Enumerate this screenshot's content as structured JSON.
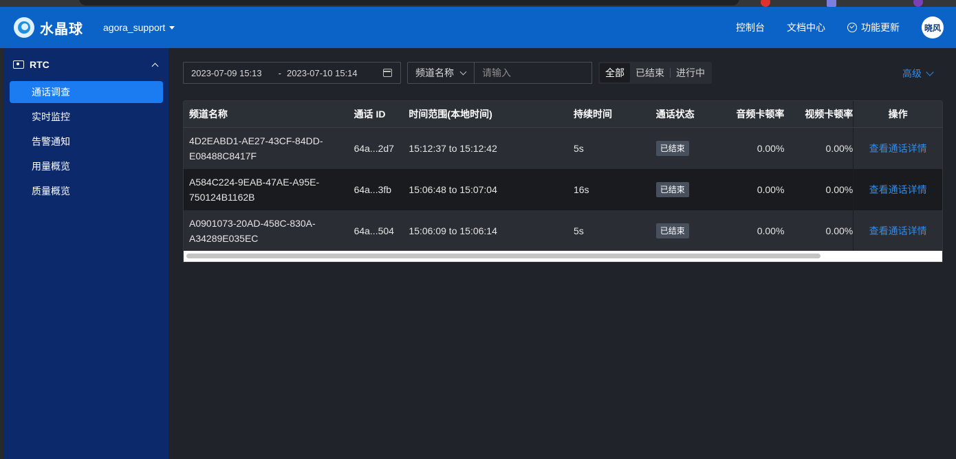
{
  "app": {
    "logo_text": "水晶球",
    "account": "agora_support"
  },
  "topnav": {
    "console": "控制台",
    "docs": "文档中心",
    "updates": "功能更新",
    "avatar": "晓风"
  },
  "sidebar": {
    "section": "RTC",
    "items": [
      {
        "label": "通话调查",
        "active": true
      },
      {
        "label": "实时监控"
      },
      {
        "label": "告警通知"
      },
      {
        "label": "用量概览"
      },
      {
        "label": "质量概览"
      }
    ]
  },
  "filters": {
    "date_start": "2023-07-09 15:13",
    "date_sep": "-",
    "date_end": "2023-07-10 15:14",
    "field_select": "频道名称",
    "search_placeholder": "请输入",
    "status_options": [
      "全部",
      "已结束",
      "进行中"
    ],
    "status_selected": "全部",
    "advanced": "高级"
  },
  "table": {
    "columns": [
      "频道名称",
      "通话 ID",
      "时间范围(本地时间)",
      "持续时间",
      "通话状态",
      "音频卡顿率",
      "视频卡顿率",
      "操作"
    ],
    "rows": [
      {
        "channel_line1": "4D2EABD1-AE27-43CF-84DD-",
        "channel_line2": "E08488C8417F",
        "call_id": "64a...2d7",
        "time_range": "15:12:37 to 15:12:42",
        "duration": "5s",
        "status": "已结束",
        "audio_freeze": "0.00%",
        "video_freeze": "0.00%",
        "action": "查看通话详情"
      },
      {
        "channel_line1": "A584C224-9EAB-47AE-A95E-",
        "channel_line2": "750124B1162B",
        "call_id": "64a...3fb",
        "time_range": "15:06:48 to 15:07:04",
        "duration": "16s",
        "status": "已结束",
        "audio_freeze": "0.00%",
        "video_freeze": "0.00%",
        "action": "查看通话详情"
      },
      {
        "channel_line1": "A0901073-20AD-458C-830A-",
        "channel_line2": "A34289E035EC",
        "call_id": "64a...504",
        "time_range": "15:06:09 to 15:06:14",
        "duration": "5s",
        "status": "已结束",
        "audio_freeze": "0.00%",
        "video_freeze": "0.00%",
        "action": "查看通话详情"
      }
    ]
  },
  "colors": {
    "topbar": "#0b63c7",
    "sidebar": "#0c2a6b",
    "sidebar_active": "#1a7cf0",
    "link": "#2f8cf0",
    "background": "#202329"
  }
}
